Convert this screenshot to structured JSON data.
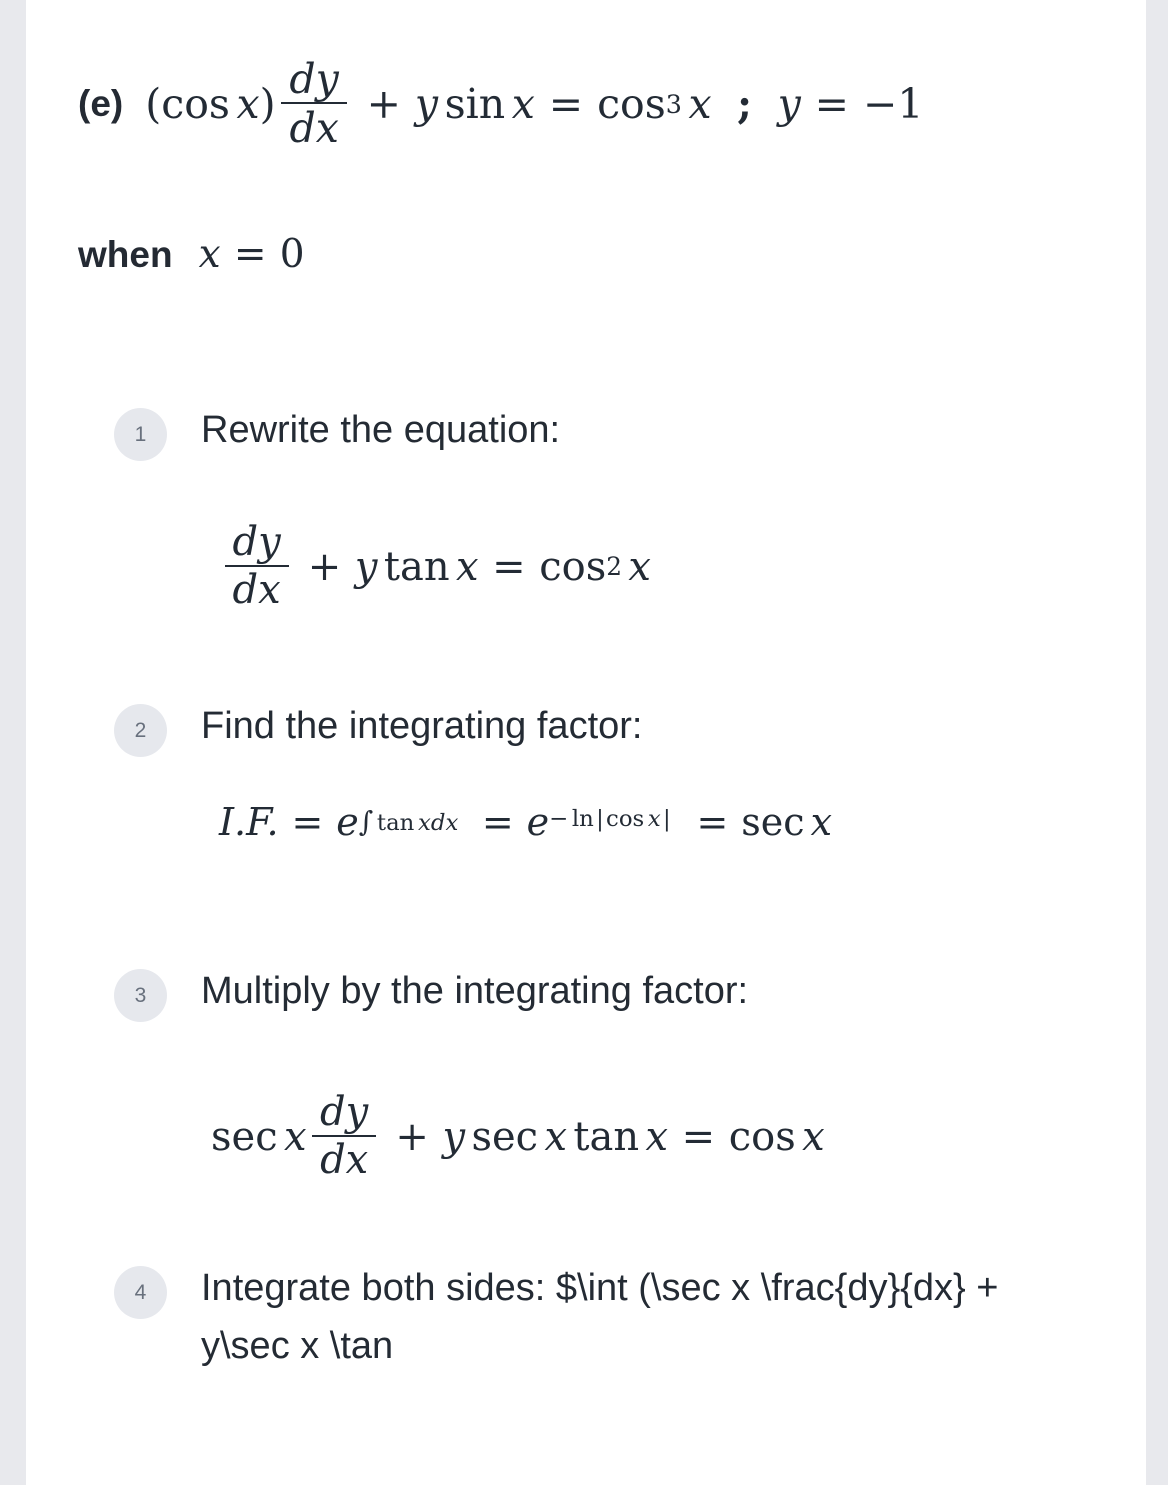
{
  "document": {
    "part_label": "(e)",
    "when_label": "when",
    "background_color": "#ffffff",
    "gutter_color": "#e8e9ed",
    "text_color": "#242b34",
    "badge_bg_color": "#e6e8ed",
    "badge_text_color": "#68707d"
  },
  "problem": {
    "equation_plain": "(cos x) dy/dx + y sin x = cos^3 x ; y = -1",
    "condition_plain": "when x = 0",
    "tokens": {
      "paren_open": "(",
      "cos": "cos",
      "x": "x",
      "paren_close": ")",
      "d": "d",
      "y": "y",
      "dx_d": "d",
      "dx_x": "x",
      "plus": "+",
      "sin": "sin",
      "equals": "=",
      "power_three": "3",
      "semicolon": ";",
      "minus_one": "−1",
      "zero": "0"
    }
  },
  "steps": [
    {
      "number": "1",
      "title": "Rewrite the equation:",
      "equation_plain": "dy/dx + y tan x = cos^2 x",
      "tokens": {
        "num_d": "d",
        "num_y": "y",
        "den_d": "d",
        "den_x": "x",
        "plus": "+",
        "y": "y",
        "tan": "tan",
        "x": "x",
        "equals": "=",
        "cos": "cos",
        "power_two": "2"
      }
    },
    {
      "number": "2",
      "title": "Find the integrating factor:",
      "equation_plain": "I.F. = e^(∫ tan x dx) = e^(− ln | cos x |) = sec x",
      "tokens": {
        "if_label": "I.F.",
        "equals": "=",
        "e": "e",
        "integral": "∫",
        "tan": "tan",
        "x": "x",
        "d": "d",
        "minus": "−",
        "ln": "ln",
        "bar": "|",
        "cos": "cos",
        "sec": "sec"
      }
    },
    {
      "number": "3",
      "title": "Multiply by the integrating factor:",
      "equation_plain": "sec x dy/dx + y sec x tan x = cos x",
      "tokens": {
        "sec": "sec",
        "x": "x",
        "num_d": "d",
        "num_y": "y",
        "den_d": "d",
        "den_x": "x",
        "plus": "+",
        "y": "y",
        "tan": "tan",
        "equals": "=",
        "cos": "cos"
      }
    },
    {
      "number": "4",
      "title": "Integrate both sides: $\\int (\\sec x \\frac{dy}{dx} + y\\sec x \\tan",
      "equation_plain": "",
      "tokens": {}
    }
  ]
}
